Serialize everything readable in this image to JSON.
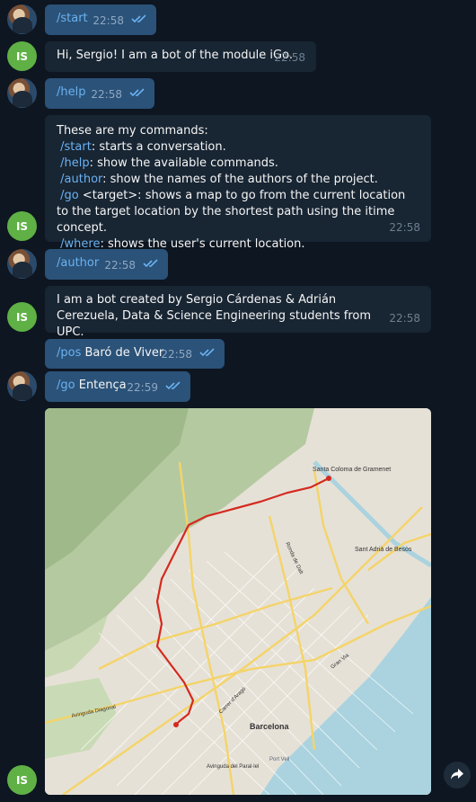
{
  "user": {
    "avatar_label": "IS"
  },
  "messages": [
    {
      "side": "out",
      "cmd": "/start",
      "text": "",
      "time": "22:58"
    },
    {
      "side": "in",
      "text": "Hi, Sergio! I am a bot of the module iGo.",
      "time": "22:58"
    },
    {
      "side": "out",
      "cmd": "/help",
      "text": "",
      "time": "22:58"
    },
    {
      "side": "in",
      "intro": "These are my commands:",
      "lines": [
        {
          "cmd": "/start",
          "rest": ": starts a conversation."
        },
        {
          "cmd": "/help",
          "rest": ": show the available commands."
        },
        {
          "cmd": "/author",
          "rest": ": show the names of the authors of the project."
        },
        {
          "cmd": "/go",
          "rest": " <target>: shows a map to go from the current location to the target location by the shortest path using the itime concept."
        },
        {
          "cmd": "/where",
          "rest": ": shows the user's current location."
        }
      ],
      "time": "22:58"
    },
    {
      "side": "out",
      "cmd": "/author",
      "text": "",
      "time": "22:58"
    },
    {
      "side": "in",
      "text": "I am a bot created by Sergio Cárdenas & Adrián Cerezuela, Data & Science Engineering students from UPC.",
      "time": "22:58"
    },
    {
      "side": "out",
      "cmd": "/pos",
      "text": " Baró de Viver",
      "time": "22:58"
    },
    {
      "side": "out",
      "cmd": "/go",
      "text": " Entença",
      "time": "22:59"
    }
  ],
  "map": {
    "labels": {
      "santa_coloma": "Santa Coloma de Gramenet",
      "sant_adria": "Sant Adrià de Besòs",
      "barcelona": "Barcelona",
      "ronda_mig": "Ronda de Dalt",
      "carrer_arago": "Carrer d'Aragó",
      "port_vell": "Port Vell",
      "av_diagonal": "Avinguda Diagonal",
      "av_parallel": "Avinguda del Paral·lel",
      "gran_via": "Gran Via"
    },
    "route_color": "#d42a1f"
  },
  "icons": {
    "share": "share-icon",
    "read_ticks": "double-check-icon"
  }
}
